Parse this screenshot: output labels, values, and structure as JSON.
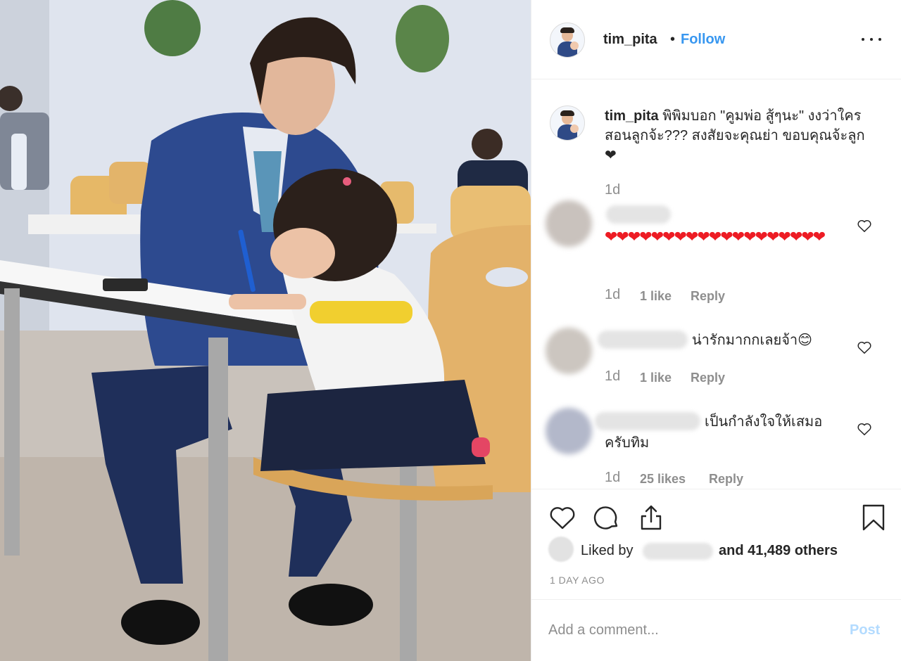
{
  "post": {
    "username": "tim_pita",
    "separator": "•",
    "follow_label": "Follow",
    "more_icon": "more-options-icon"
  },
  "caption": {
    "username": "tim_pita",
    "text": "พิพิมบอก \"คูมพ่อ สู้ๆนะ\" งงว่าใครสอนลูกจ้ะ??? สงสัยจะคุณย่า ขอบคุณจ้ะลูก ❤",
    "time": "1d"
  },
  "comments": [
    {
      "text": "❤❤❤❤❤❤❤❤❤❤❤❤❤❤❤❤❤❤❤",
      "time": "1d",
      "likes": "1 like",
      "reply": "Reply"
    },
    {
      "text": "น่ารักมากกเลยจ้า😊",
      "time": "1d",
      "likes": "1 like",
      "reply": "Reply"
    },
    {
      "text": "เป็นกำลังใจให้เสมอ ครับทิม",
      "time": "1d",
      "likes": "25 likes",
      "reply": "Reply"
    }
  ],
  "actions": {
    "liked_by": "Liked by",
    "likes_rest": "and 41,489 others",
    "timestamp": "1 DAY AGO",
    "icons": [
      "heart-icon",
      "comment-icon",
      "share-icon",
      "bookmark-icon"
    ]
  },
  "add_comment": {
    "placeholder": "Add a comment...",
    "post_label": "Post"
  },
  "colors": {
    "link": "#3897f0",
    "muted": "#8e8e8e",
    "post_disabled": "#b3dbff",
    "heart": "#ed1c24"
  }
}
